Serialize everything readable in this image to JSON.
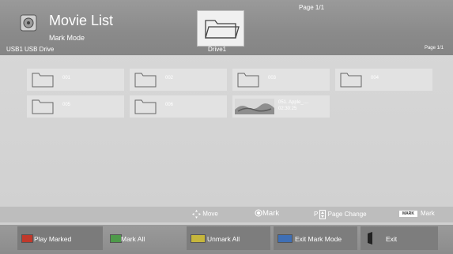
{
  "header": {
    "title": "Movie List",
    "mode": "Mark Mode",
    "usb_label": "USB1",
    "usb_name": "USB Drive",
    "drive": "Drive1",
    "page_top": "Page 1/1",
    "page_right": "Page 1/1"
  },
  "items": [
    {
      "name": "001"
    },
    {
      "name": "002"
    },
    {
      "name": "003"
    },
    {
      "name": "004"
    },
    {
      "name": "005"
    },
    {
      "name": "006"
    },
    {
      "name": "051. Apple_....",
      "duration": "02:30:25"
    }
  ],
  "hints": {
    "move": "Move",
    "mark": "Mark",
    "page_prefix": "P",
    "page_change": "Page Change",
    "mark_tag": "MARK",
    "mark2": "Mark"
  },
  "buttons": {
    "play_marked": "Play Marked",
    "mark_all": "Mark All",
    "unmark_all": "Unmark All",
    "exit_mark_mode": "Exit Mark Mode",
    "exit": "Exit"
  },
  "colors": {
    "header": "#8a8a8a",
    "red": "#c0392b",
    "green": "#4e9a4a",
    "yellow": "#c6b63c",
    "blue": "#3f6fb5"
  }
}
